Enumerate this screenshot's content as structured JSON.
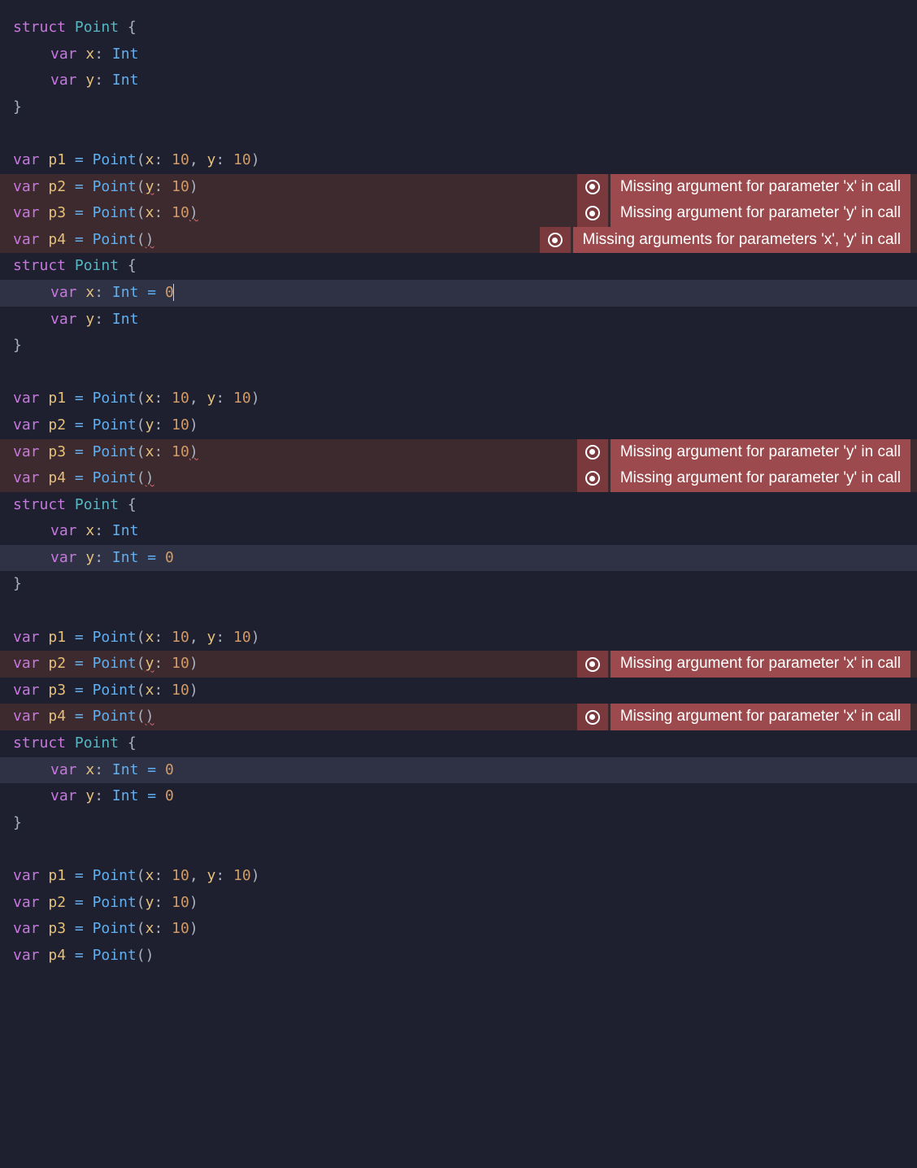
{
  "kw": {
    "struct": "struct",
    "var": "var"
  },
  "types": {
    "Point": "Point",
    "Int": "Int"
  },
  "props": {
    "x": "x",
    "y": "y"
  },
  "nums": {
    "ten": "10",
    "zero": "0"
  },
  "vars": {
    "p1": "p1",
    "p2": "p2",
    "p3": "p3",
    "p4": "p4"
  },
  "punct": {
    "lbrace": "{",
    "rbrace": "}",
    "colon": ":",
    "eq": "=",
    "lparen": "(",
    "rparen": ")",
    "comma": ","
  },
  "errors": {
    "missingX": "Missing argument for parameter 'x' in call",
    "missingY": "Missing argument for parameter 'y' in call",
    "missingXY": "Missing arguments for parameters 'x', 'y' in call"
  },
  "blocks": [
    {
      "xDefault": null,
      "yDefault": null,
      "lines": [
        {
          "err": null
        },
        {
          "err": "missingX",
          "underline": "y"
        },
        {
          "err": "missingY",
          "underline": "rparen"
        },
        {
          "err": "missingXY",
          "underline": "rparen"
        }
      ],
      "highlightLine": null
    },
    {
      "xDefault": "0",
      "yDefault": null,
      "lines": [
        {
          "err": null
        },
        {
          "err": null
        },
        {
          "err": "missingY",
          "underline": "rparen"
        },
        {
          "err": "missingY",
          "underline": "rparen"
        }
      ],
      "highlightLine": "x"
    },
    {
      "xDefault": null,
      "yDefault": "0",
      "lines": [
        {
          "err": null
        },
        {
          "err": "missingX",
          "underline": "y"
        },
        {
          "err": null
        },
        {
          "err": "missingX",
          "underline": "rparen"
        }
      ],
      "highlightLine": "y"
    },
    {
      "xDefault": "0",
      "yDefault": "0",
      "lines": [
        {
          "err": null
        },
        {
          "err": null
        },
        {
          "err": null
        },
        {
          "err": null
        }
      ],
      "highlightLine": "x"
    }
  ]
}
